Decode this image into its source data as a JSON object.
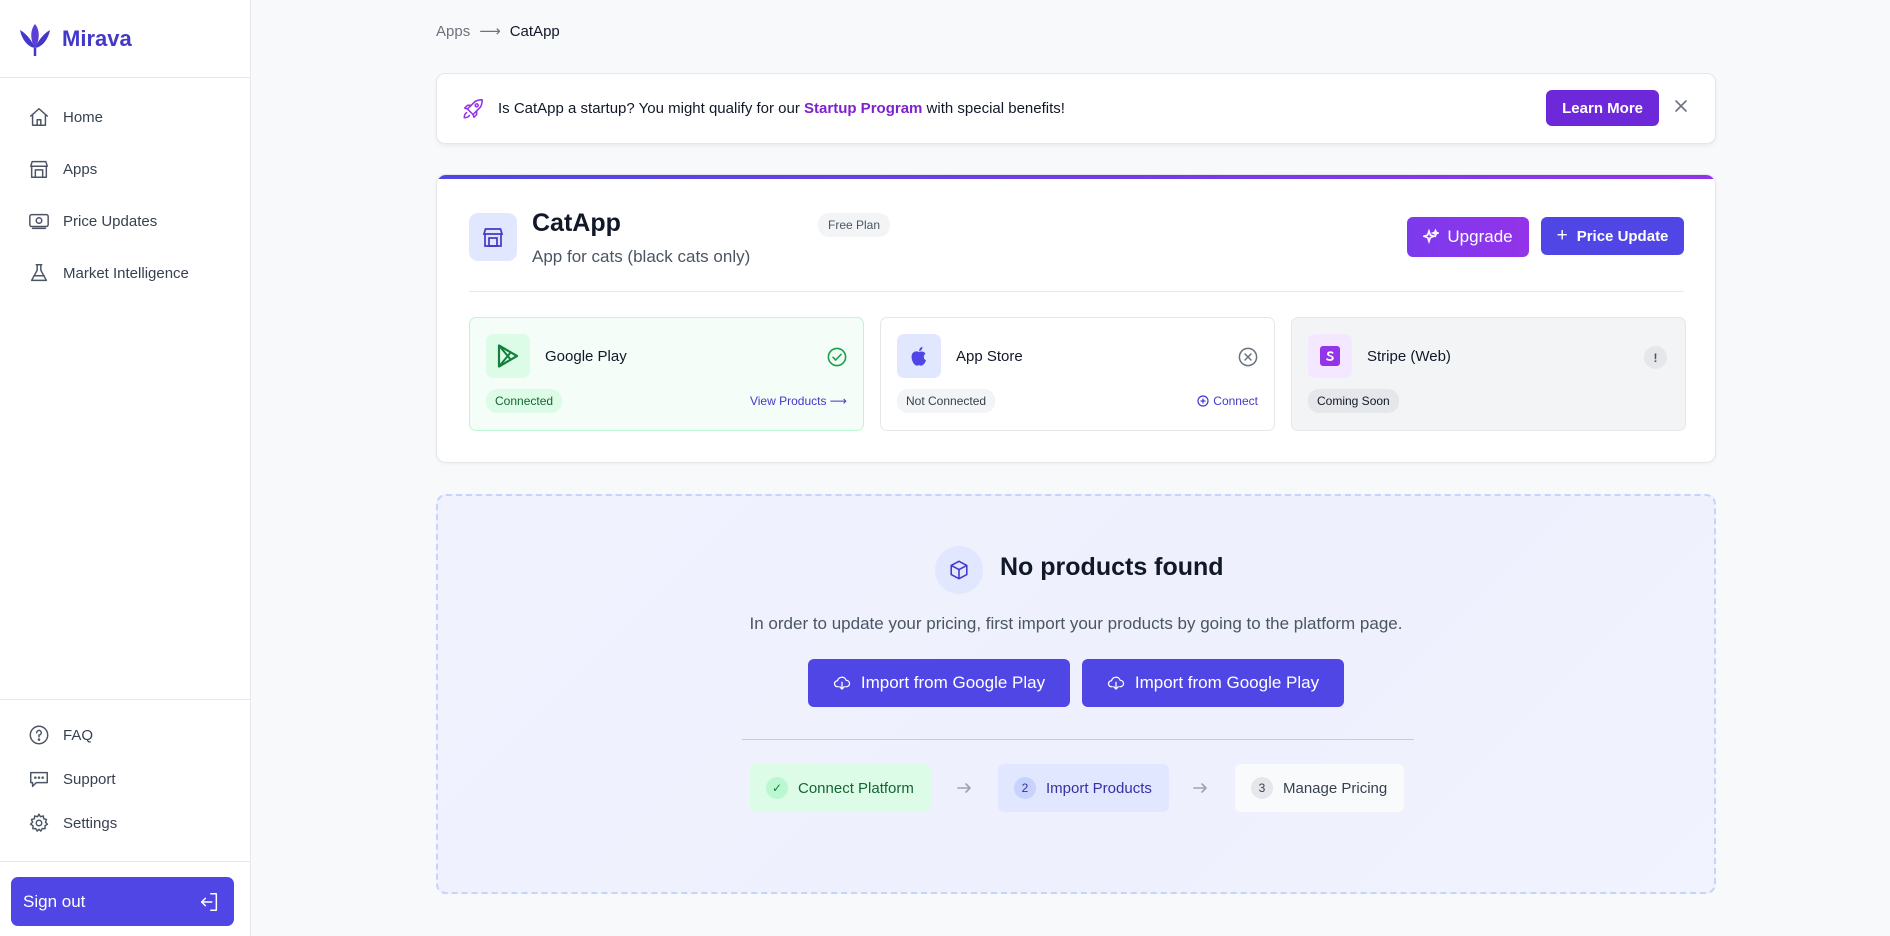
{
  "brand": {
    "name": "Mirava"
  },
  "sidebar": {
    "items": [
      {
        "label": "Home",
        "icon": "home-icon"
      },
      {
        "label": "Apps",
        "icon": "store-icon"
      },
      {
        "label": "Price Updates",
        "icon": "banknote-icon"
      },
      {
        "label": "Market Intelligence",
        "icon": "flask-icon"
      }
    ],
    "bottom_items": [
      {
        "label": "FAQ",
        "icon": "help-circle-icon"
      },
      {
        "label": "Support",
        "icon": "chat-bubble-icon"
      },
      {
        "label": "Settings",
        "icon": "gear-icon"
      }
    ],
    "sign_out": "Sign out"
  },
  "breadcrumb": {
    "parent": "Apps",
    "separator": "⟶",
    "current": "CatApp"
  },
  "banner": {
    "text_before": "Is CatApp a startup? You might qualify for our ",
    "link": "Startup Program",
    "text_after": " with special benefits!",
    "cta": "Learn More"
  },
  "app": {
    "name": "CatApp",
    "plan": "Free Plan",
    "description": "App for cats (black cats only)",
    "upgrade_label": "Upgrade",
    "price_update_label": "Price Update"
  },
  "platforms": [
    {
      "name": "Google Play",
      "status": "Connected",
      "action": "View Products ⟶"
    },
    {
      "name": "App Store",
      "status": "Not Connected",
      "action": "Connect"
    },
    {
      "name": "Stripe (Web)",
      "status": "Coming Soon",
      "indicator": "!"
    }
  ],
  "empty_state": {
    "title": "No products found",
    "message": "In order to update your pricing, first import your products by going to the platform page.",
    "buttons": [
      "Import from Google Play",
      "Import from Google Play"
    ],
    "steps": [
      {
        "marker": "✓",
        "label": "Connect Platform"
      },
      {
        "marker": "2",
        "label": "Import Products"
      },
      {
        "marker": "3",
        "label": "Manage Pricing"
      }
    ]
  },
  "colors": {
    "brand": "#4338ca",
    "primary": "#4f46e5",
    "accent": "#7e22ce",
    "success": "#16a34a"
  }
}
